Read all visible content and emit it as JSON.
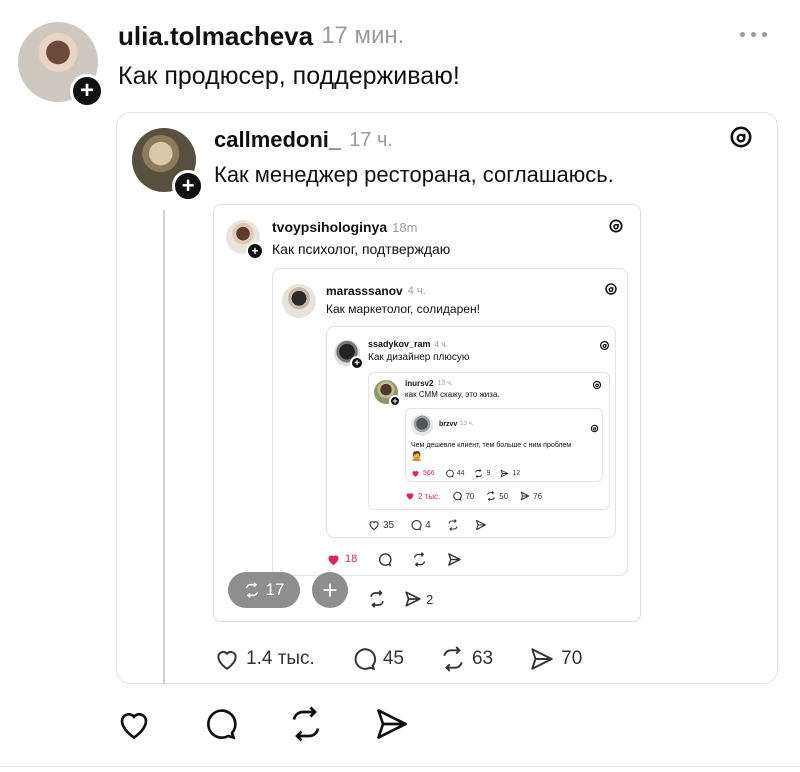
{
  "post": {
    "username": "ulia.tolmacheva",
    "time": "17 мин.",
    "text": "Как продюсер, поддерживаю!"
  },
  "q1": {
    "username": "callmedoni_",
    "time": "17 ч.",
    "text": "Как менеджер ресторана, соглашаюсь.",
    "likes": "1.4 тыс.",
    "comments": "45",
    "reposts": "63",
    "shares": "70"
  },
  "q2": {
    "username": "tvoypsihologinya",
    "time": "18m",
    "text": "Как психолог, подтверждаю",
    "likes": "18",
    "shares": "2",
    "repost_pill": "17"
  },
  "q3": {
    "username": "marasssanov",
    "time": "4 ч.",
    "text": "Как маркетолог, солидарен!",
    "likes": "35",
    "comments": "4"
  },
  "q4": {
    "username": "ssadykov_ram",
    "time": "4 ч.",
    "text": "Как дизайнер плюсую",
    "likes": "2 тыс.",
    "comments": "70",
    "reposts": "50",
    "shares": "76"
  },
  "q5": {
    "username": "inursv2",
    "time": "13 ч.",
    "text": "как СММ скажу, это жиза.",
    "likes": "566",
    "comments": "44",
    "reposts": "9",
    "shares": "12"
  },
  "q6": {
    "username": "brzvv",
    "time": "13 ч.",
    "text": "Чем дешевле клиент, тем больше с ним проблем",
    "emoji": "🤦"
  },
  "colors": {
    "like_red": "#e0245e",
    "muted": "#9a9a9a"
  }
}
